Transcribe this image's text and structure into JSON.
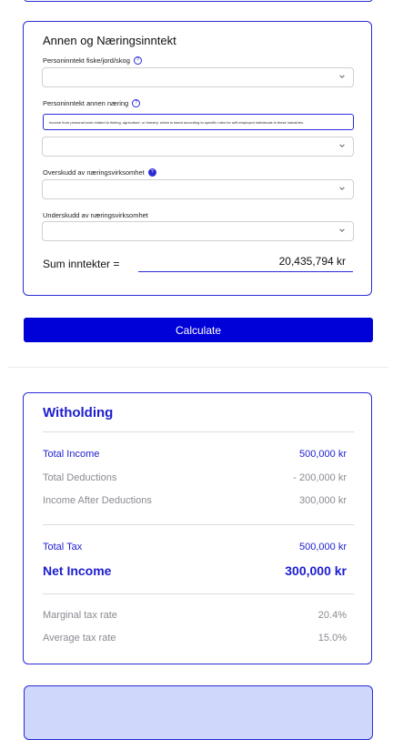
{
  "income_section": {
    "title": "Annen og Næringsinntekt",
    "fields": [
      {
        "label": "Personinntekt fiske/jord/skog",
        "value": ""
      },
      {
        "label": "Personinntekt annen næring",
        "value": ""
      },
      {
        "label": "Overskudd av næringsvirksomhet",
        "value": ""
      },
      {
        "label": "Underskudd av næringsvirksomhet",
        "value": ""
      }
    ],
    "tooltip_text": "Income from personal work related to fishing, agriculture, or forestry, which is taxed according to specific rules for self-employed individuals in these industries.",
    "sum_label": "Sum inntekter =",
    "sum_value": "20,435,794 kr"
  },
  "calculate_label": "Calculate",
  "withholding": {
    "title": "Witholding",
    "rows": [
      {
        "label": "Total Income",
        "value": "500,000 kr"
      },
      {
        "label": "Total Deductions",
        "value": "- 200,000 kr"
      },
      {
        "label": "Income After Deductions",
        "value": "300,000 kr"
      },
      {
        "label": "Total Tax",
        "value": "500,000 kr"
      },
      {
        "label": "Net Income",
        "value": "300,000 kr"
      },
      {
        "label": "Marginal tax rate",
        "value": "20.4%"
      },
      {
        "label": "Average tax rate",
        "value": "15.0%"
      }
    ]
  },
  "colors": {
    "accent": "#0000d8",
    "border": "#2b2bd6",
    "muted": "#8a8a92",
    "panel": "#cfd8fb"
  },
  "icons": {
    "help": "question-circle-icon",
    "chevron": "chevron-down-icon"
  }
}
